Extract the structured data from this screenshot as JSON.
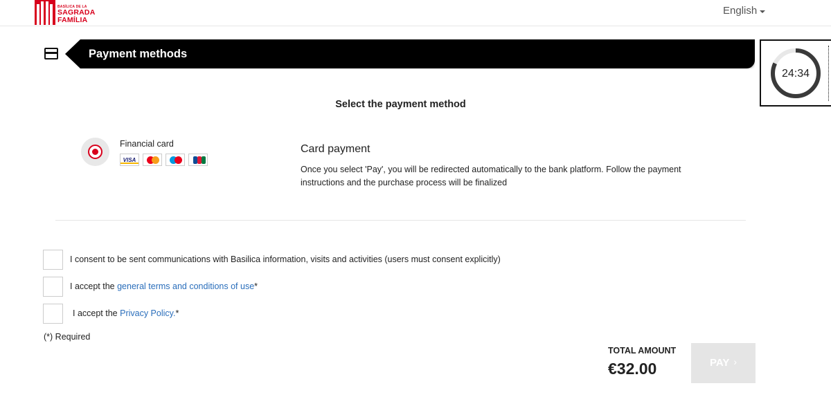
{
  "header": {
    "logo": {
      "line1": "BASÍLICA DE LA",
      "line2": "SAGRADA",
      "line3": "FAMÍLIA"
    },
    "language": "English"
  },
  "section": {
    "title": "Payment methods",
    "icon": "credit-card-icon"
  },
  "timer": {
    "value": "24:34",
    "progress": 0.82
  },
  "payment": {
    "heading": "Select the payment method",
    "option_label": "Financial card",
    "selected": true,
    "card_brands": [
      "VISA",
      "MasterCard",
      "Maestro",
      "JCB"
    ],
    "method_title": "Card payment",
    "method_description": "Once you select 'Pay', you will be redirected automatically to the bank platform. Follow the payment instructions and the purchase process will be finalized"
  },
  "consents": [
    {
      "prefix": "I consent to be sent communications with Basilica information, visits and activities (users must consent explicitly)",
      "link": "",
      "suffix": "",
      "checked": false
    },
    {
      "prefix": "I accept the ",
      "link": "general terms and conditions of use",
      "suffix": "*",
      "checked": false
    },
    {
      "prefix": "I accept the ",
      "link": "Privacy Policy.",
      "suffix": "*",
      "checked": false
    }
  ],
  "required_note": "(*) Required",
  "total": {
    "label": "TOTAL AMOUNT",
    "amount": "€32.00"
  },
  "pay_button": {
    "label": "PAY",
    "chevron": "›",
    "enabled": false
  },
  "colors": {
    "brand_red": "#d8001c",
    "link_blue": "#2a6ebb",
    "banner_black": "#000000",
    "disabled_button": "#e5e5e5"
  }
}
